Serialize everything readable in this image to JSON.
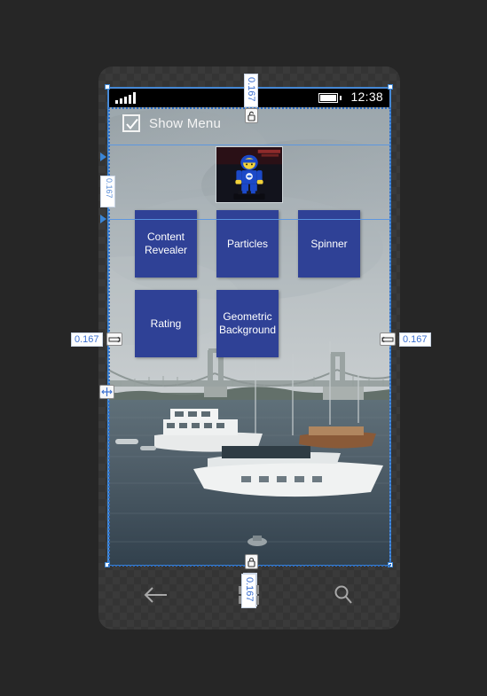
{
  "designer": {
    "tool": "xaml-visual-designer",
    "accent_color": "#3b86d6",
    "selection_color": "#2f6fc4",
    "gridline_color": "#5a96e1",
    "star_values": {
      "top": "0.167",
      "left": "0.167",
      "right": "0.167",
      "bottom": "0.167",
      "row_badge": "0.167"
    },
    "adorner_icons": {
      "top": "unlock-icon",
      "bottom": "lock-icon",
      "left": "row-resize-icon",
      "right": "row-resize-icon",
      "gridsplitter": "grid-splitter-icon",
      "row_marker": "triangle-right-icon"
    }
  },
  "device": {
    "name": "windows-phone",
    "statusbar": {
      "signal_icon": "signal-bars-icon",
      "battery_icon": "battery-full-icon",
      "time": "12:38"
    },
    "systemnav": {
      "back_label": "back-icon",
      "start_label": "windows-icon",
      "search_label": "search-icon"
    }
  },
  "app": {
    "checkbox": {
      "label": "Show Menu",
      "checked": true,
      "icon": "checkmark-icon"
    },
    "image": {
      "name": "lego-spaceman-photo",
      "alt": "Blue LEGO spaceman minifigure on a black base"
    },
    "background": {
      "name": "harbor-bridge-photo",
      "alt": "Sailboats in a harbor beneath a suspension bridge"
    },
    "tiles": [
      [
        {
          "label": "Content Revealer"
        },
        {
          "label": "Particles"
        },
        {
          "label": "Spinner"
        }
      ],
      [
        {
          "label": "Rating"
        },
        {
          "label": "Geometric Background"
        }
      ]
    ],
    "tile_color": "#2f4196"
  }
}
